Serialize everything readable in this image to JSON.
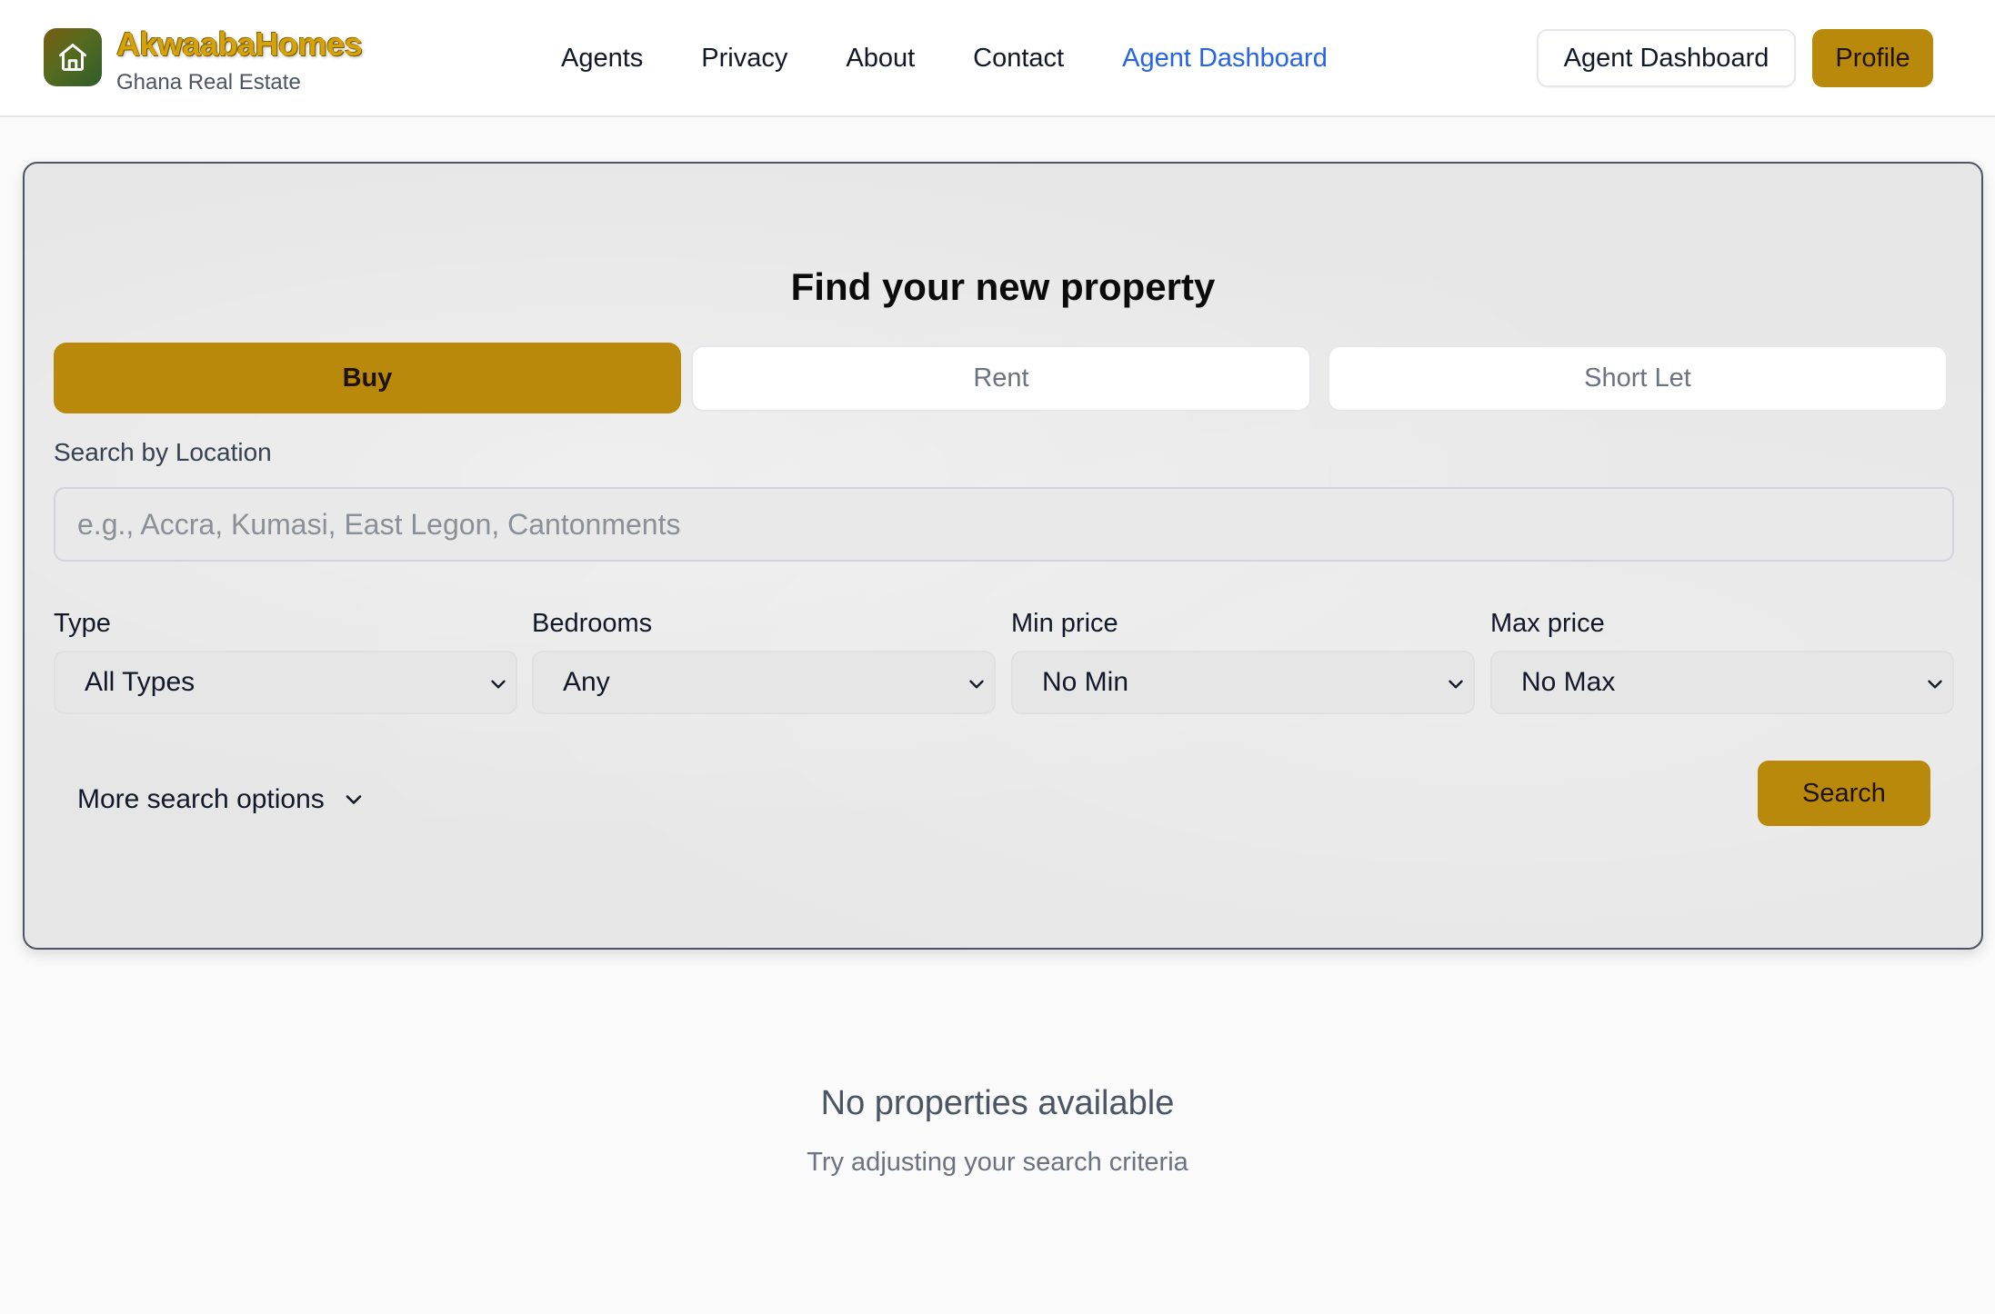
{
  "brand": {
    "name": "AkwaabaHomes",
    "tagline": "Ghana Real Estate"
  },
  "nav": {
    "links": [
      "Agents",
      "Privacy",
      "About",
      "Contact",
      "Agent Dashboard"
    ],
    "active": "Agent Dashboard"
  },
  "header_actions": {
    "dashboard_label": "Agent Dashboard",
    "profile_label": "Profile"
  },
  "search": {
    "title": "Find your new property",
    "tabs": [
      "Buy",
      "Rent",
      "Short Let"
    ],
    "selected_tab": "Buy",
    "location_label": "Search by Location",
    "location_placeholder": "e.g., Accra, Kumasi, East Legon, Cantonments",
    "location_value": "",
    "filters": [
      {
        "label": "Type",
        "value": "All Types"
      },
      {
        "label": "Bedrooms",
        "value": "Any"
      },
      {
        "label": "Min price",
        "value": "No Min"
      },
      {
        "label": "Max price",
        "value": "No Max"
      }
    ],
    "more_options_label": "More search options",
    "search_button_label": "Search"
  },
  "empty_state": {
    "title": "No properties available",
    "subtitle": "Try adjusting your search criteria"
  },
  "colors": {
    "accent_gold": "#b8890a",
    "link_active": "#2563eb",
    "page_bg": "#fafafa",
    "card_bg": "#e6e6e6"
  },
  "icons": {
    "logo": "house-icon",
    "dropdown": "chevron-down-icon"
  }
}
